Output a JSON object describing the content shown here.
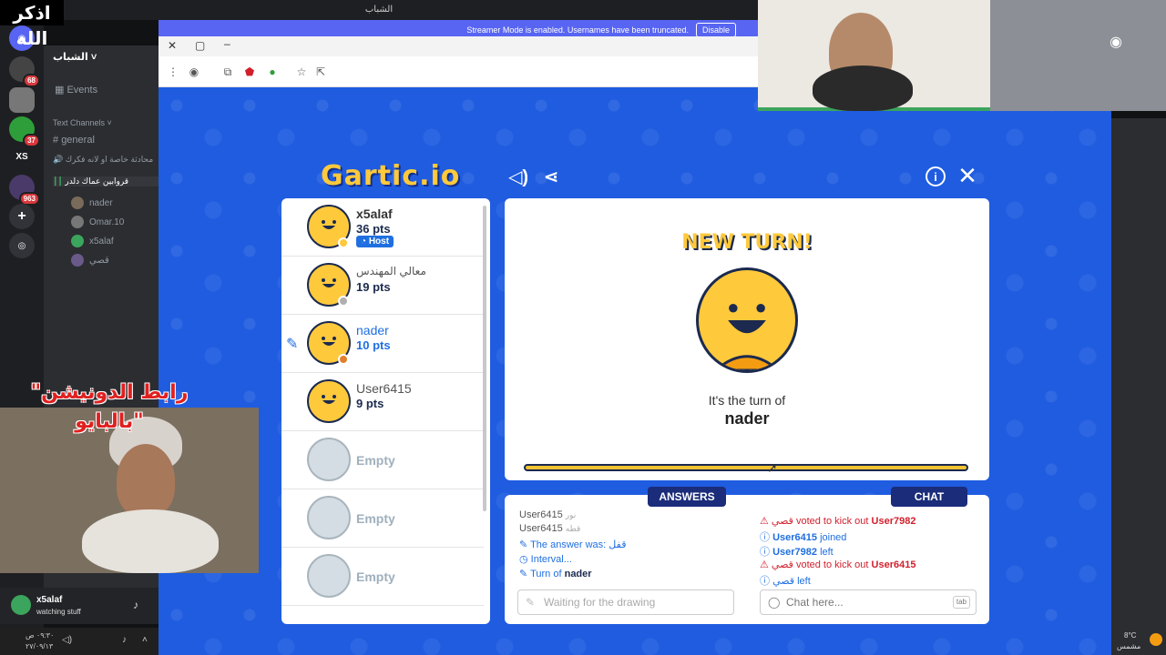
{
  "overlay": {
    "dhikr": "اذكر الله",
    "donation": "\"رابط الدونيشن بالبايو\""
  },
  "topbar": {
    "title": "الشباب"
  },
  "streamer_bar": {
    "text": "Streamer Mode is enabled. Usernames have been truncated.",
    "disable": "Disable"
  },
  "rail": {
    "badges": [
      "68",
      "37",
      "963"
    ],
    "xs": "XS"
  },
  "channels": {
    "server": "الشباب",
    "events": "Events",
    "text_header": "Text Channels",
    "general": "general",
    "voice1": "محادثة خاصة او لانه فكرك",
    "voice2": "قروابين عماك دلدر",
    "members": [
      "nader",
      "Omar.10",
      "x5alaf",
      "قصي"
    ]
  },
  "userbar": {
    "name": "x5alaf",
    "status": "watching stuff"
  },
  "taskbar": {
    "time": "٠٩:٣٠ ص",
    "date": "٢٧/٠٩/١٣"
  },
  "weather": {
    "temp": "8°C",
    "desc": "مشمس"
  },
  "game": {
    "logo": "Gartic.io",
    "players": [
      {
        "name": "x5alaf",
        "pts": "36 pts",
        "host": "Host",
        "color": "#ffc93c"
      },
      {
        "name": "معالي المهندس",
        "pts": "19 pts",
        "color": "#b0b0b0"
      },
      {
        "name": "nader",
        "pts": "10 pts",
        "color": "#e0802a"
      },
      {
        "name": "User6415",
        "pts": "9 pts"
      },
      {
        "name": "Empty"
      },
      {
        "name": "Empty"
      },
      {
        "name": "Empty"
      }
    ],
    "new_turn": "NEW TURN!",
    "turn_of": "It's the turn of",
    "turn_name": "nader",
    "answers_tab": "ANSWERS",
    "chat_tab": "CHAT",
    "answers": [
      {
        "user": "User6415",
        "text": "نور"
      },
      {
        "user": "User6415",
        "text": "قطه"
      },
      {
        "prefix": "The answer was:",
        "text": "قفل"
      },
      {
        "text": "Interval..."
      },
      {
        "prefix": "Turn of",
        "text": "nader"
      }
    ],
    "answer_placeholder": "Waiting for the drawing",
    "chat": [
      {
        "user": "قصي",
        "text": "voted to kick out",
        "target": "User7982"
      },
      {
        "user": "User6415",
        "text": "joined"
      },
      {
        "user": "User7982",
        "text": "left"
      },
      {
        "user": "قصي",
        "text": "voted to kick out",
        "target": "User6415"
      },
      {
        "user": "قصي",
        "text": "left"
      }
    ],
    "chat_placeholder": "Chat here...",
    "chat_tabkey": "tab"
  }
}
